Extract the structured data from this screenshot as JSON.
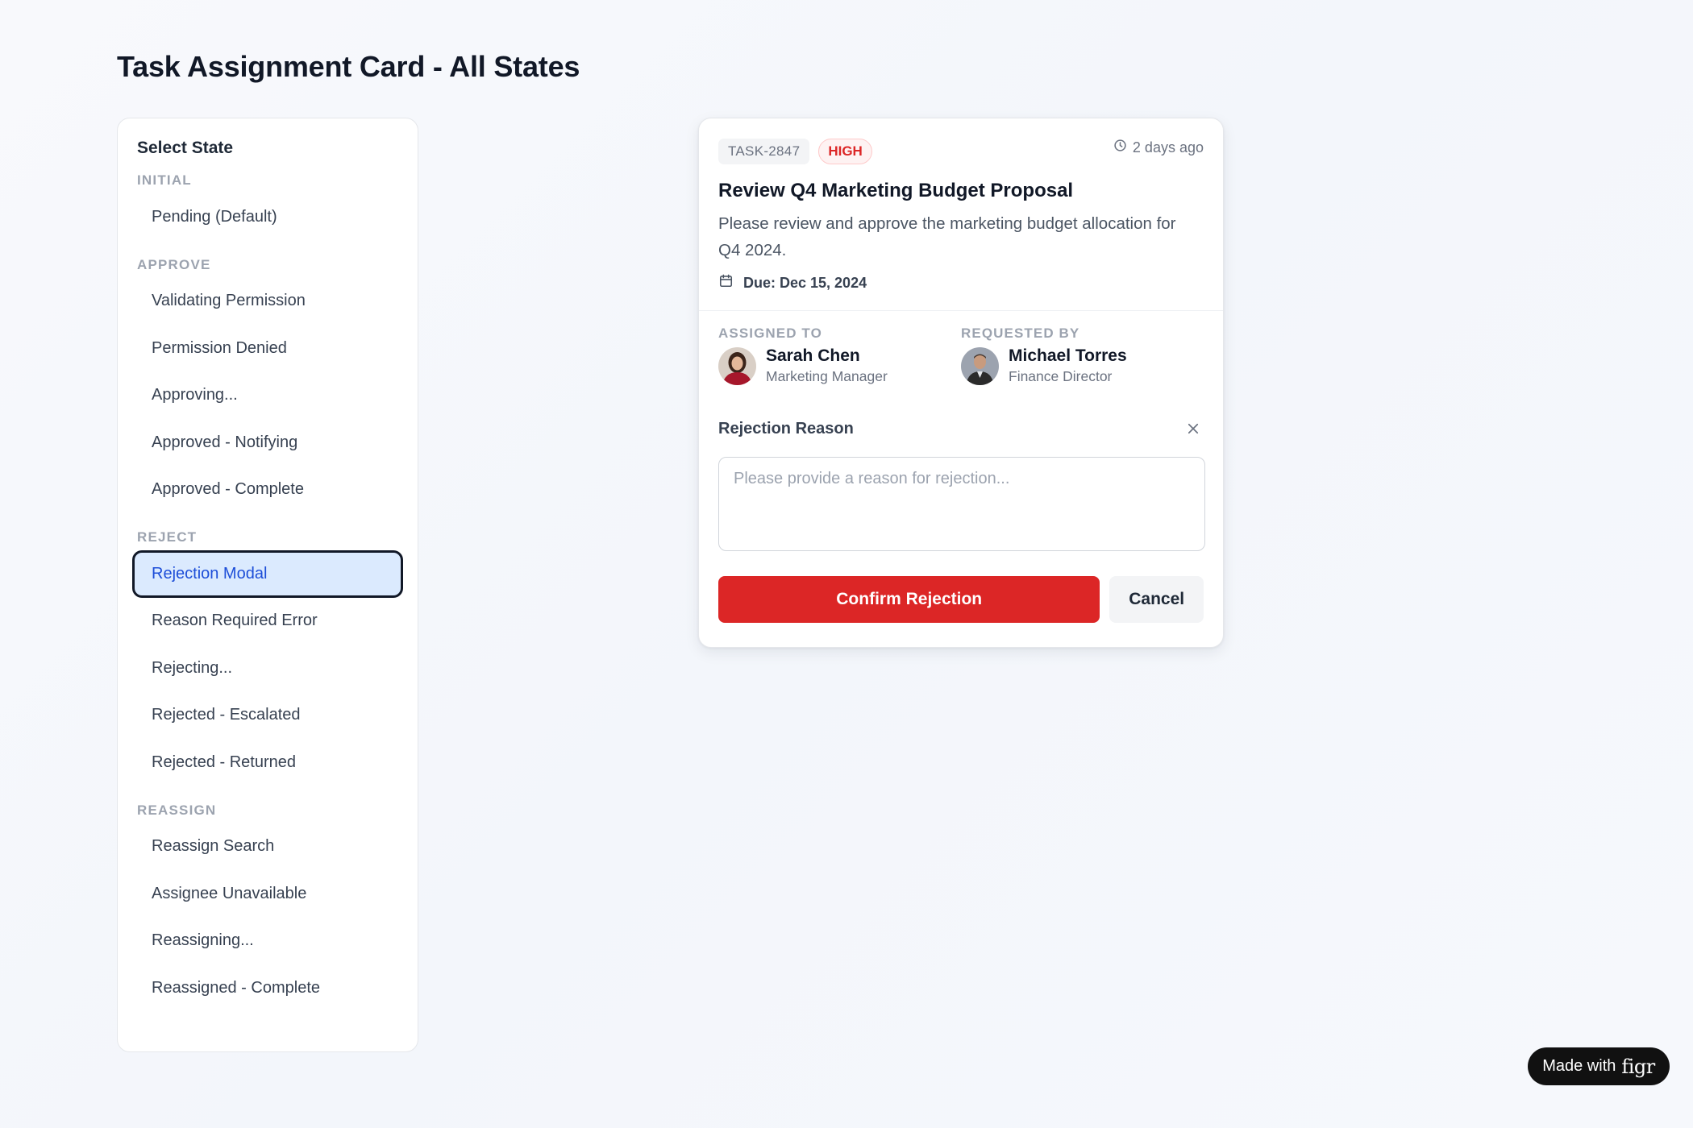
{
  "page": {
    "title": "Task Assignment Card - All States"
  },
  "sidebar": {
    "title": "Select State",
    "groups": [
      {
        "label": "INITIAL",
        "items": [
          "Pending (Default)"
        ]
      },
      {
        "label": "APPROVE",
        "items": [
          "Validating Permission",
          "Permission Denied",
          "Approving...",
          "Approved - Notifying",
          "Approved - Complete"
        ]
      },
      {
        "label": "REJECT",
        "items": [
          "Rejection Modal",
          "Reason Required Error",
          "Rejecting...",
          "Rejected - Escalated",
          "Rejected - Returned"
        ]
      },
      {
        "label": "REASSIGN",
        "items": [
          "Reassign Search",
          "Assignee Unavailable",
          "Reassigning...",
          "Reassigned - Complete"
        ]
      }
    ],
    "active_item": "Rejection Modal"
  },
  "card": {
    "task_id": "TASK-2847",
    "priority": "HIGH",
    "time_ago": "2 days ago",
    "title": "Review Q4 Marketing Budget Proposal",
    "description": "Please review and approve the marketing budget allocation for Q4 2024.",
    "due": "Due: Dec 15, 2024",
    "assigned_to": {
      "label": "ASSIGNED TO",
      "name": "Sarah Chen",
      "role": "Marketing Manager"
    },
    "requested_by": {
      "label": "REQUESTED BY",
      "name": "Michael Torres",
      "role": "Finance Director"
    },
    "rejection": {
      "label": "Rejection Reason",
      "placeholder": "Please provide a reason for rejection...",
      "value": "",
      "confirm_label": "Confirm Rejection",
      "cancel_label": "Cancel"
    }
  },
  "badge": {
    "text": "Made with",
    "logo": "figr"
  },
  "colors": {
    "accent_red": "#dc2626",
    "active_bg": "#dbeafe",
    "active_text": "#1d4ed8",
    "priority_bg": "#fef2f2"
  },
  "icons": [
    "clock-icon",
    "calendar-icon",
    "close-icon"
  ]
}
